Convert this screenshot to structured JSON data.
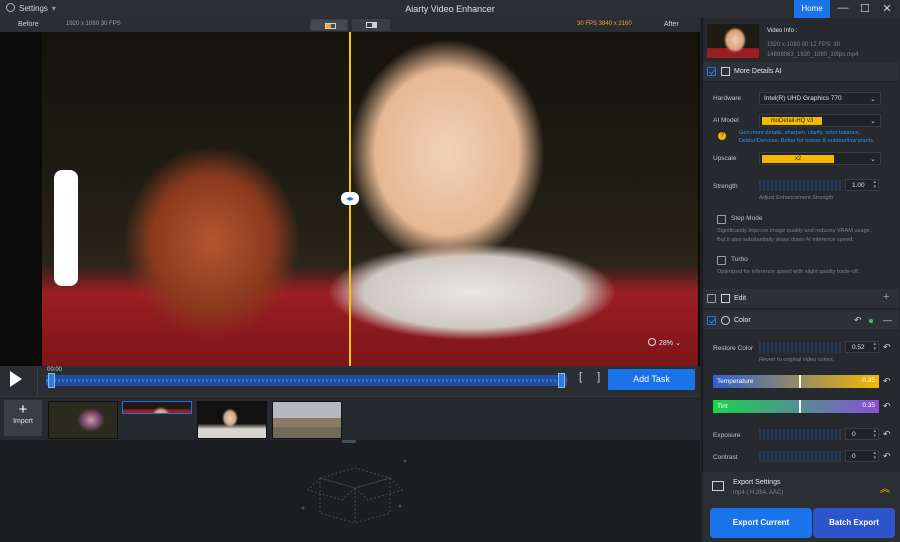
{
  "titlebar": {
    "settings": "Settings",
    "title": "Aiarty Video Enhancer",
    "home": "Home",
    "minimize": "—",
    "maximize": "☐",
    "close": "✕"
  },
  "preview": {
    "before": "Before",
    "after": "After",
    "info_left": "1920 x 1080  30 FPS",
    "info_right": "30 FPS  3840 x 2160",
    "zoom": "28%",
    "zoom_caret": "⌄"
  },
  "transport": {
    "time": "00:00",
    "brackets": "[ ]",
    "add_task": "Add Task"
  },
  "filmstrip": {
    "import_label": "Import",
    "thumb_count": 4
  },
  "panel": {
    "video_info": {
      "heading": "Video Info :",
      "line1": "1920 x 1080  00:12   FPS: 30",
      "line2": "14898083_1920_1080_30fps.mp4"
    },
    "more_details": {
      "label": "More Details AI",
      "checked": true
    },
    "hardware": {
      "label": "Hardware",
      "value": "Intel(R) UHD Graphics 770"
    },
    "ai_model": {
      "label": "AI Model",
      "value": "moDetail-HQ  v3",
      "tip": "Gen more details, sharpen, clarify, color balance, Deblur/Denoise. Better for indoor & outdoor/low plants."
    },
    "upscale": {
      "label": "Upscale",
      "value": "x2"
    },
    "strength": {
      "label": "Strength",
      "value": "1.00",
      "sub": "Adjust Enhancement Strength"
    },
    "step_mode": {
      "label": "Step Mode",
      "sub1": "Significantly improve image quality and reduces VRAM usage.",
      "sub2": "But it also substantially slows down AI inference speed."
    },
    "turbo": {
      "label": "Turbo",
      "sub": "Optimized for inference speed with slight quality trade-off."
    },
    "edit": {
      "label": "Edit",
      "add": "+"
    },
    "color": {
      "label": "Color",
      "collapse": "—",
      "restore": {
        "label": "Restore Color",
        "value": "0.52",
        "sub": "Revert to original video colors."
      },
      "temperature": {
        "label": "Temperature",
        "value": "-0.35",
        "level": 0.52
      },
      "tint": {
        "label": "Tint",
        "value": "0.35",
        "level": 0.52
      },
      "exposure": {
        "label": "Exposure",
        "value": "0"
      },
      "contrast": {
        "label": "Contrast",
        "value": "0"
      }
    },
    "export_settings": {
      "label": "Export Settings",
      "format": "mp4 ( H.264, AAC)",
      "chevron": "︽"
    }
  },
  "buttons": {
    "export_current": "Export Current",
    "batch_export": "Batch Export"
  },
  "colors": {
    "accent": "#1a73e8",
    "highlight": "#f5b700",
    "divider": "#f5c518"
  }
}
